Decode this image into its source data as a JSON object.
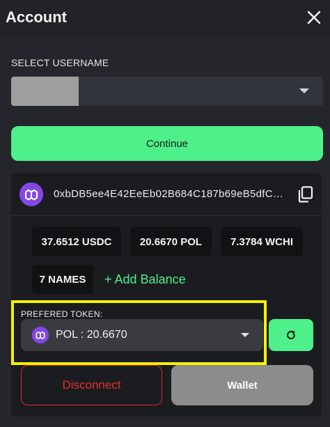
{
  "modal": {
    "title": "Account"
  },
  "username": {
    "label": "SELECT USERNAME",
    "selected_value": ""
  },
  "buttons": {
    "continue": "Continue",
    "disconnect": "Disconnect",
    "wallet": "Wallet",
    "add_balance": "+ Add Balance"
  },
  "account": {
    "address": "0xbDB5ee4E42EeEb02B684C187b69eB5dfCb…",
    "balances": [
      "37.6512 USDC",
      "20.6670 POL",
      "7.3784 WCHI",
      "7 NAMES"
    ]
  },
  "preferred_token": {
    "label": "PREFERED TOKEN:",
    "selected_value": "POL : 20.6670"
  },
  "icons": {
    "close": "close-icon",
    "dropdown": "chevron-down-icon",
    "polygon": "polygon-logo-icon",
    "copy": "copy-icon",
    "refresh": "refresh-icon"
  },
  "colors": {
    "accent": "#4ef08a",
    "danger": "#e03131",
    "highlight": "#f7f100",
    "polygon": "#8247e5"
  }
}
